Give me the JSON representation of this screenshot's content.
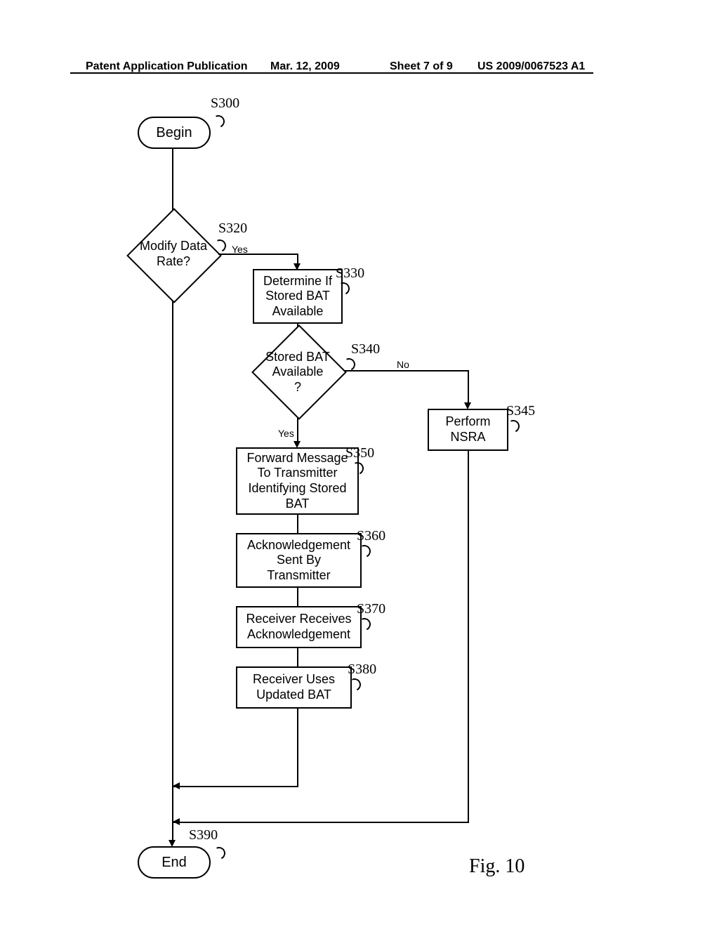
{
  "header": {
    "left": "Patent Application Publication",
    "date": "Mar. 12, 2009",
    "sheet": "Sheet 7 of 9",
    "pubno": "US 2009/0067523 A1"
  },
  "figure_label": "Fig. 10",
  "refs": {
    "s300": "S300",
    "s320": "S320",
    "s330": "S330",
    "s340": "S340",
    "s345": "S345",
    "s350": "S350",
    "s360": "S360",
    "s370": "S370",
    "s380": "S380",
    "s390": "S390"
  },
  "nodes": {
    "begin": "Begin",
    "end": "End",
    "decide_rate": "Modify Data\nRate?",
    "s330": "Determine If\nStored BAT\nAvailable",
    "decide_bat": "Stored BAT\nAvailable\n?",
    "s345": "Perform\nNSRA",
    "s350": "Forward Message\nTo Transmitter\nIdentifying Stored\nBAT",
    "s360": "Acknowledgement\nSent By\nTransmitter",
    "s370": "Receiver Receives\nAcknowledgement",
    "s380": "Receiver Uses\nUpdated BAT"
  },
  "edges": {
    "yes": "Yes",
    "no": "No"
  },
  "chart_data": {
    "type": "flowchart",
    "title": "Fig. 10",
    "nodes": [
      {
        "id": "S300",
        "type": "terminator",
        "label": "Begin"
      },
      {
        "id": "S320",
        "type": "decision",
        "label": "Modify Data Rate?"
      },
      {
        "id": "S330",
        "type": "process",
        "label": "Determine If Stored BAT Available"
      },
      {
        "id": "S340",
        "type": "decision",
        "label": "Stored BAT Available ?"
      },
      {
        "id": "S345",
        "type": "process",
        "label": "Perform NSRA"
      },
      {
        "id": "S350",
        "type": "process",
        "label": "Forward Message To Transmitter Identifying Stored BAT"
      },
      {
        "id": "S360",
        "type": "process",
        "label": "Acknowledgement Sent By Transmitter"
      },
      {
        "id": "S370",
        "type": "process",
        "label": "Receiver Receives Acknowledgement"
      },
      {
        "id": "S380",
        "type": "process",
        "label": "Receiver Uses Updated BAT"
      },
      {
        "id": "S390",
        "type": "terminator",
        "label": "End"
      }
    ],
    "edges": [
      {
        "from": "S300",
        "to": "S320"
      },
      {
        "from": "S320",
        "to": "S330",
        "label": "Yes"
      },
      {
        "from": "S320",
        "to": "S390",
        "label": ""
      },
      {
        "from": "S330",
        "to": "S340"
      },
      {
        "from": "S340",
        "to": "S350",
        "label": "Yes"
      },
      {
        "from": "S340",
        "to": "S345",
        "label": "No"
      },
      {
        "from": "S350",
        "to": "S360"
      },
      {
        "from": "S360",
        "to": "S370"
      },
      {
        "from": "S370",
        "to": "S380"
      },
      {
        "from": "S380",
        "to": "S390"
      },
      {
        "from": "S345",
        "to": "S390"
      }
    ]
  }
}
